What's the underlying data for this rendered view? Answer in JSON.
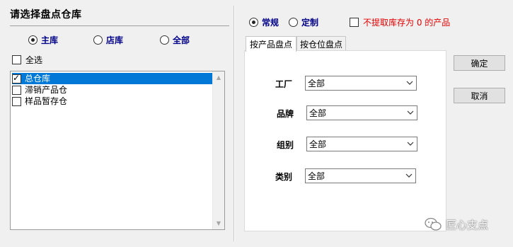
{
  "left_panel": {
    "title": "请选择盘点仓库",
    "scope_options": [
      "主库",
      "店库",
      "全部"
    ],
    "scope_selected": "主库",
    "select_all_label": "全选",
    "warehouses": [
      {
        "name": "总仓库",
        "checked": true,
        "selected": true
      },
      {
        "name": "滞销产品仓",
        "checked": false,
        "selected": false
      },
      {
        "name": "样品暂存仓",
        "checked": false,
        "selected": false
      }
    ]
  },
  "right_panel": {
    "mode_options": [
      "常规",
      "定制"
    ],
    "mode_selected": "常规",
    "exclude_zero_label": "不提取库存为 0 的产品",
    "tabs": [
      "按产品盘点",
      "按仓位盘点"
    ],
    "active_tab": "按产品盘点",
    "fields": [
      {
        "label": "工厂",
        "value": "全部"
      },
      {
        "label": "品牌",
        "value": "全部"
      },
      {
        "label": "组别",
        "value": "全部"
      },
      {
        "label": "类别",
        "value": "全部"
      }
    ]
  },
  "buttons": {
    "confirm": "确定",
    "cancel": "取消"
  },
  "watermark": {
    "text": "匠心支点",
    "icon": "wechat-icon"
  },
  "colors": {
    "selection": "#0078d7",
    "option_text": "#00008b",
    "warning_text": "#e60000"
  }
}
